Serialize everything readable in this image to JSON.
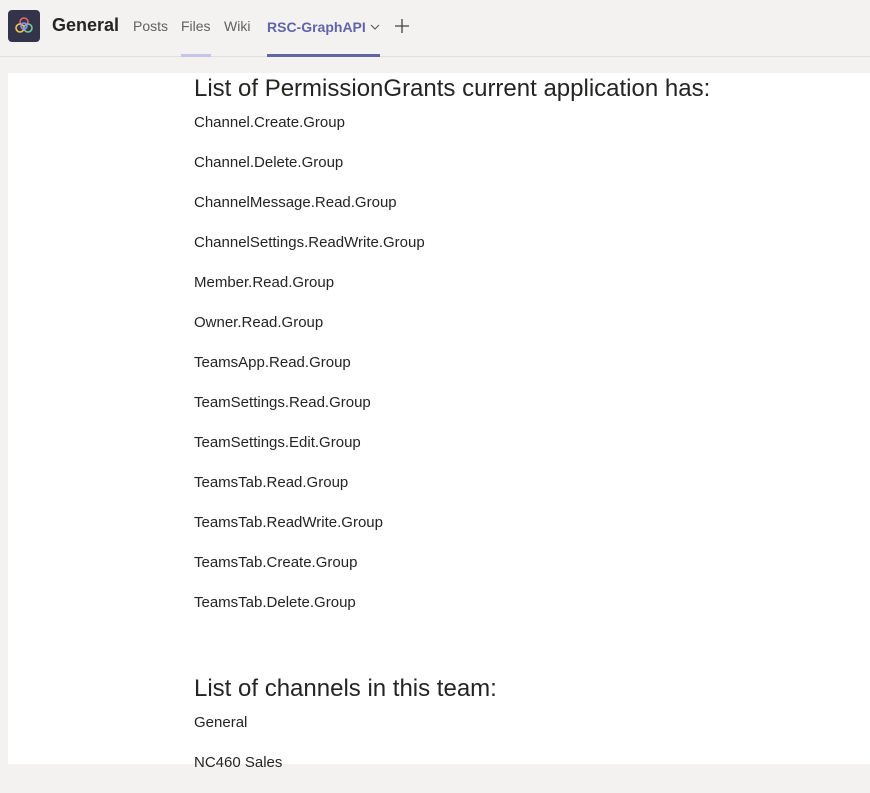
{
  "header": {
    "channel_name": "General",
    "tabs": [
      {
        "label": "Posts",
        "active": false,
        "underlined": false
      },
      {
        "label": "Files",
        "active": false,
        "underlined": true
      },
      {
        "label": "Wiki",
        "active": false,
        "underlined": false
      },
      {
        "label": "RSC-GraphAPI",
        "active": true,
        "underlined": true
      }
    ],
    "add_tab_icon": "plus-icon",
    "team_icon": "team-logo-icon",
    "accent_color": "#6264a7"
  },
  "main": {
    "permissions_heading": "List of PermissionGrants current application has:",
    "permissions": [
      "Channel.Create.Group",
      "Channel.Delete.Group",
      "ChannelMessage.Read.Group",
      "ChannelSettings.ReadWrite.Group",
      "Member.Read.Group",
      "Owner.Read.Group",
      "TeamsApp.Read.Group",
      "TeamSettings.Read.Group",
      "TeamSettings.Edit.Group",
      "TeamsTab.Read.Group",
      "TeamsTab.ReadWrite.Group",
      "TeamsTab.Create.Group",
      "TeamsTab.Delete.Group"
    ],
    "channels_heading": "List of channels in this team:",
    "channels": [
      "General",
      "NC460 Sales"
    ]
  }
}
